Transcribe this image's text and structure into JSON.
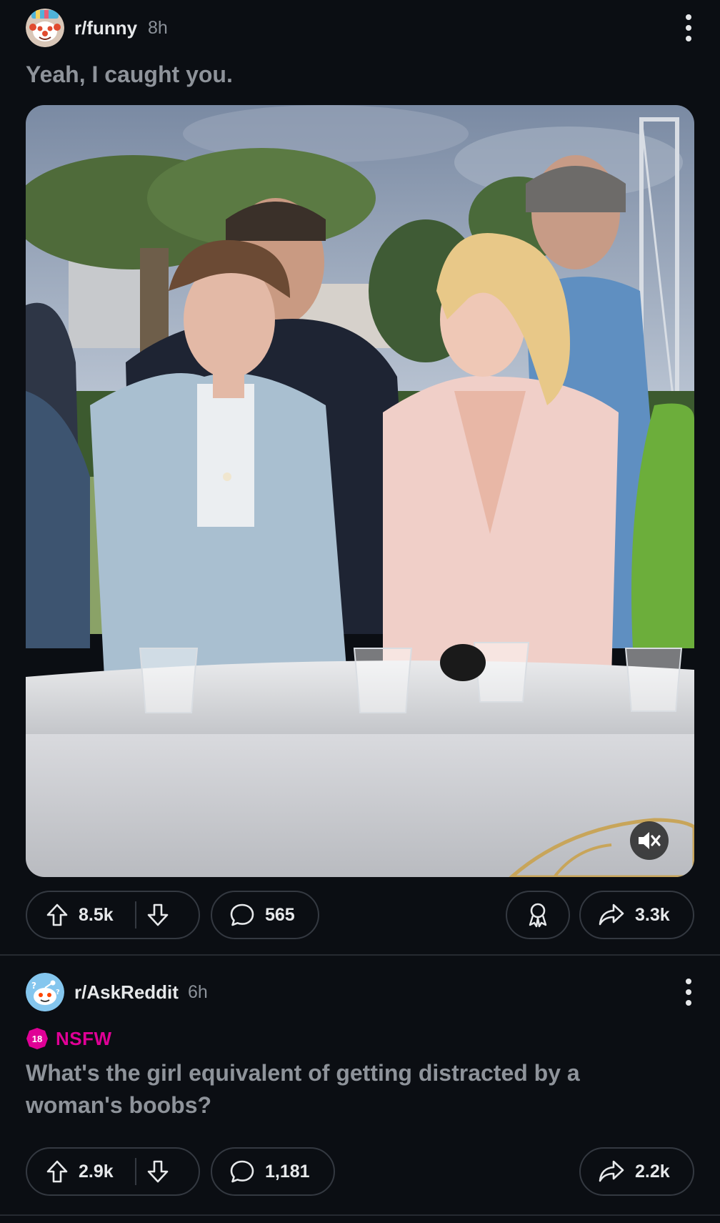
{
  "posts": [
    {
      "subreddit": "r/funny",
      "age": "8h",
      "title": "Yeah, I caught you.",
      "upvotes": "8.5k",
      "comments": "565",
      "shares": "3.3k",
      "media": "video",
      "muted": true,
      "avatar_icon": "funny-subreddit-avatar-icon"
    },
    {
      "subreddit": "r/AskReddit",
      "age": "6h",
      "nsfw_age": "18",
      "nsfw_label": "NSFW",
      "title": "What's the girl equivalent of getting distracted by a woman's boobs?",
      "upvotes": "2.9k",
      "comments": "1,181",
      "shares": "2.2k",
      "avatar_icon": "askreddit-subreddit-avatar-icon"
    }
  ],
  "colors": {
    "background": "#0b0e13",
    "title_text": "#8e939a",
    "nsfw": "#e00096",
    "pill_border": "#343941"
  }
}
